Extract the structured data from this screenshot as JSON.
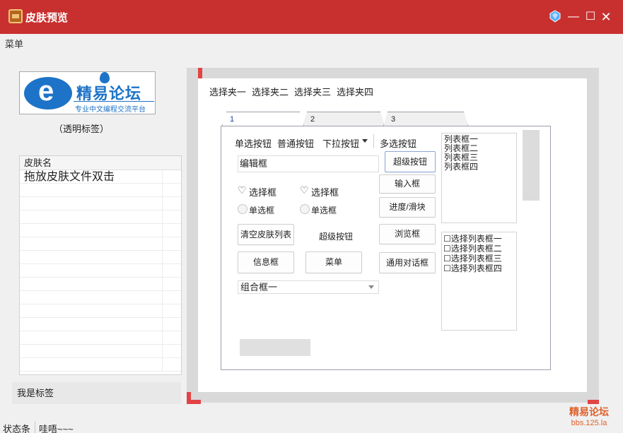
{
  "window": {
    "title": "皮肤预览",
    "controls": {
      "skin": "skin-icon",
      "minimize": "—",
      "maximize": "☐",
      "close": "✕"
    }
  },
  "menubar": {
    "items": [
      "菜单"
    ]
  },
  "logo": {
    "title": "精易论坛",
    "subtitle": "专业中文编程交流平台"
  },
  "transparent_label": "（透明标签）",
  "skin_list": {
    "header": "皮肤名",
    "rows": [
      "拖放皮肤文件双击",
      "",
      "",
      "",
      "",
      "",
      "",
      "",
      "",
      "",
      "",
      "",
      "",
      "",
      ""
    ]
  },
  "bottom_label": "我是标签",
  "statusbar": {
    "left": "状态条",
    "right": "哇唔~~~"
  },
  "watermark": {
    "line1": "精易论坛",
    "line2": "bbs.125.la"
  },
  "selector_tabs": [
    "选择夹一",
    "选择夹二",
    "选择夹三",
    "选择夹四"
  ],
  "tabs": [
    "1",
    "2",
    "3"
  ],
  "panel": {
    "radio_button": "单选按钮",
    "normal_button": "普通按钮",
    "dropdown_button": "下拉按钮",
    "multi_select_button": "多选按钮",
    "edit_box": "编辑框",
    "super_button_1": "超级按钮",
    "input_box": "输入框",
    "progress_slider": "进度/滑块",
    "browse_box": "浏览框",
    "common_dialog": "通用对话框",
    "checkbox_1": "选择框",
    "checkbox_2": "选择框",
    "radio_1": "单选框",
    "radio_2": "单选框",
    "clear_skin_list": "清空皮肤列表",
    "super_button_2": "超级按钮",
    "info_box": "信息框",
    "menu_button": "菜单",
    "combo_box": "组合框一",
    "progress": 0
  },
  "listbox": [
    "列表框一",
    "列表框二",
    "列表框三",
    "列表框四"
  ],
  "check_listbox": [
    "☐选择列表框一",
    "☐选择列表框二",
    "☐选择列表框三",
    "☐选择列表框四"
  ],
  "colors": {
    "title_bar": "#c8302f",
    "accent_mark": "#e24343",
    "watermark": "#e0602a"
  }
}
